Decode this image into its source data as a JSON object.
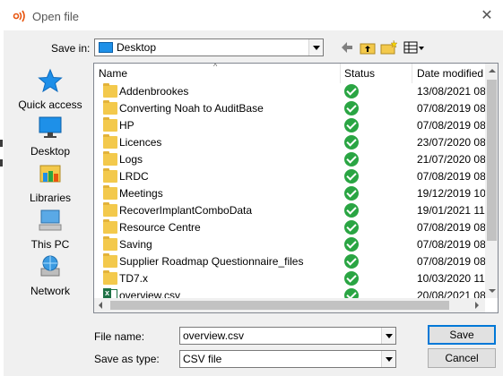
{
  "window": {
    "title": "Open file",
    "close_glyph": "✕",
    "accent": "#e8550f"
  },
  "save_in": {
    "label": "Save in:",
    "value": "Desktop"
  },
  "places": [
    {
      "label": "Quick access",
      "icon": "star-icon"
    },
    {
      "label": "Desktop",
      "icon": "desktop-icon"
    },
    {
      "label": "Libraries",
      "icon": "libraries-icon"
    },
    {
      "label": "This PC",
      "icon": "computer-icon"
    },
    {
      "label": "Network",
      "icon": "network-icon"
    }
  ],
  "columns": {
    "name": "Name",
    "status": "Status",
    "date": "Date modified"
  },
  "files": [
    {
      "name": "Addenbrookes",
      "type": "folder",
      "date": "13/08/2021 08:"
    },
    {
      "name": "Converting Noah to AuditBase",
      "type": "folder",
      "date": "07/08/2019 08:"
    },
    {
      "name": "HP",
      "type": "folder",
      "date": "07/08/2019 08:"
    },
    {
      "name": "Licences",
      "type": "folder",
      "date": "23/07/2020 08:"
    },
    {
      "name": "Logs",
      "type": "folder",
      "date": "21/07/2020 08:"
    },
    {
      "name": "LRDC",
      "type": "folder",
      "date": "07/08/2019 08:"
    },
    {
      "name": "Meetings",
      "type": "folder",
      "date": "19/12/2019 10:"
    },
    {
      "name": "RecoverImplantComboData",
      "type": "folder",
      "date": "19/01/2021 11:"
    },
    {
      "name": "Resource Centre",
      "type": "folder",
      "date": "07/08/2019 08:"
    },
    {
      "name": "Saving",
      "type": "folder",
      "date": "07/08/2019 08:"
    },
    {
      "name": "Supplier Roadmap Questionnaire_files",
      "type": "folder",
      "date": "07/08/2019 08:"
    },
    {
      "name": "TD7.x",
      "type": "folder",
      "date": "10/03/2020 11:"
    },
    {
      "name": "overview.csv",
      "type": "csv",
      "date": "20/08/2021 08:"
    }
  ],
  "file_name": {
    "label": "File name:",
    "value": "overview.csv"
  },
  "save_as_type": {
    "label": "Save as type:",
    "value": "CSV file"
  },
  "buttons": {
    "save": "Save",
    "cancel": "Cancel"
  }
}
